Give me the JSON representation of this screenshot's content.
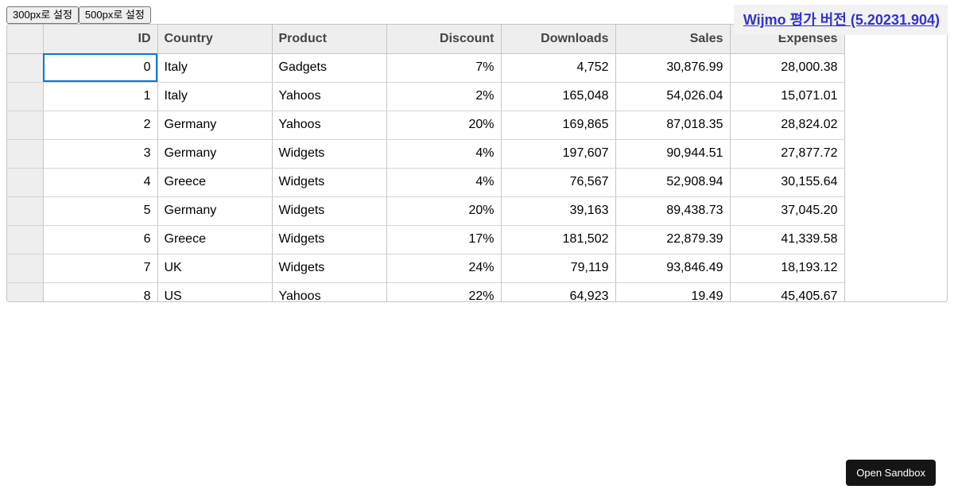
{
  "toolbar": {
    "btn_300": "300px로 설정",
    "btn_500": "500px로 설정"
  },
  "banner": {
    "link_text": "Wijmo 평가 버전 (5.20231.904)"
  },
  "grid": {
    "columns": [
      "ID",
      "Country",
      "Product",
      "Discount",
      "Downloads",
      "Sales",
      "Expenses"
    ],
    "rows": [
      [
        "0",
        "Italy",
        "Gadgets",
        "7%",
        "4,752",
        "30,876.99",
        "28,000.38"
      ],
      [
        "1",
        "Italy",
        "Yahoos",
        "2%",
        "165,048",
        "54,026.04",
        "15,071.01"
      ],
      [
        "2",
        "Germany",
        "Yahoos",
        "20%",
        "169,865",
        "87,018.35",
        "28,824.02"
      ],
      [
        "3",
        "Germany",
        "Widgets",
        "4%",
        "197,607",
        "90,944.51",
        "27,877.72"
      ],
      [
        "4",
        "Greece",
        "Widgets",
        "4%",
        "76,567",
        "52,908.94",
        "30,155.64"
      ],
      [
        "5",
        "Germany",
        "Widgets",
        "20%",
        "39,163",
        "89,438.73",
        "37,045.20"
      ],
      [
        "6",
        "Greece",
        "Widgets",
        "17%",
        "181,502",
        "22,879.39",
        "41,339.58"
      ],
      [
        "7",
        "UK",
        "Widgets",
        "24%",
        "79,119",
        "93,846.49",
        "18,193.12"
      ],
      [
        "8",
        "US",
        "Yahoos",
        "22%",
        "64,923",
        "19.49",
        "45,405.67"
      ]
    ]
  },
  "sandbox": {
    "label": "Open Sandbox"
  },
  "colors": {
    "selection": "#0078d4",
    "header_bg": "#eeeeee",
    "sandbox_bg": "#151515"
  }
}
